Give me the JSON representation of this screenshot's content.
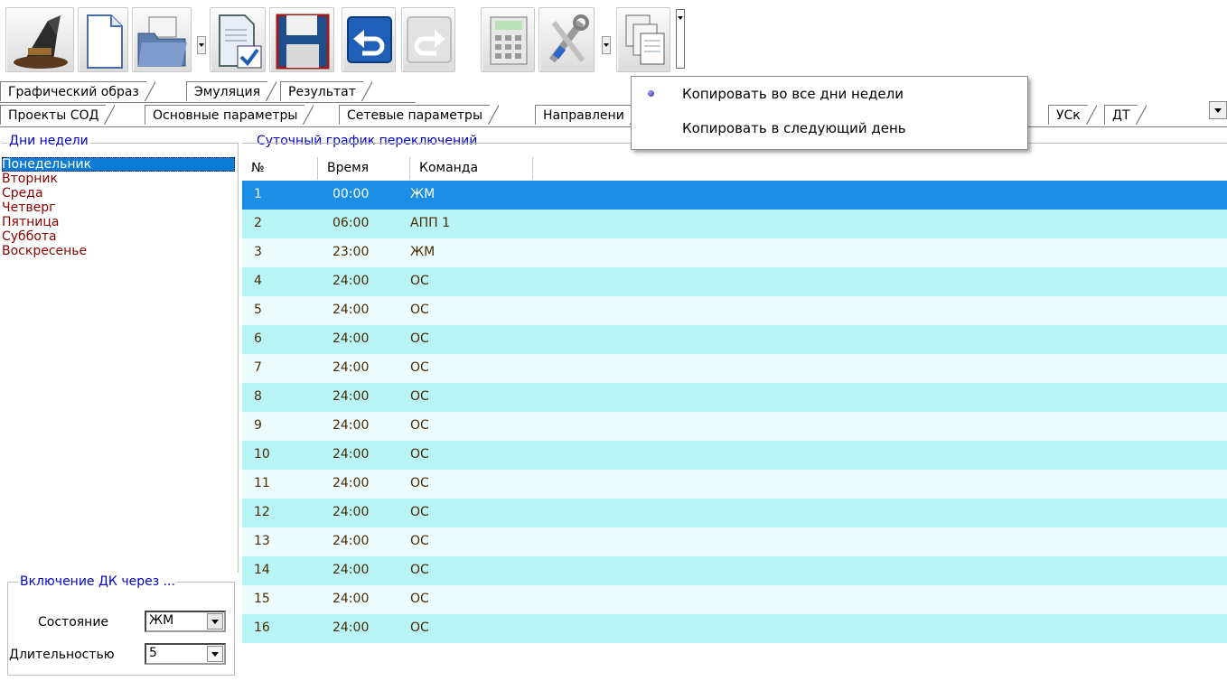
{
  "toolbar": {
    "icons": [
      "wizard-hat-icon",
      "new-document-icon",
      "open-folder-icon",
      "check-document-icon",
      "save-disk-icon",
      "undo-icon",
      "redo-icon",
      "calculator-icon",
      "tools-icon",
      "copy-documents-icon"
    ]
  },
  "tabs_top": [
    "Графический образ",
    "Эмуляция",
    "Результат"
  ],
  "tabs_second": [
    "Проекты СОД",
    "Основные параметры",
    "Сетевые параметры",
    "Направлени",
    "УСк",
    "ДТ"
  ],
  "left": {
    "days_title": "Дни недели",
    "days": [
      "Понедельник",
      "Вторник",
      "Среда",
      "Четверг",
      "Пятница",
      "Суббота",
      "Воскресенье"
    ],
    "dk_title": "Включение ДК через ...",
    "state_label": "Состояние",
    "state_value": "ЖМ",
    "duration_label": "Длительностью",
    "duration_value": "5"
  },
  "schedule": {
    "title": "Суточный график переключений",
    "columns": [
      "№",
      "Время",
      "Команда"
    ],
    "rows": [
      {
        "n": "1",
        "t": "00:00",
        "c": "ЖМ"
      },
      {
        "n": "2",
        "t": "06:00",
        "c": "АПП 1"
      },
      {
        "n": "3",
        "t": "23:00",
        "c": "ЖМ"
      },
      {
        "n": "4",
        "t": "24:00",
        "c": "ОС"
      },
      {
        "n": "5",
        "t": "24:00",
        "c": "ОС"
      },
      {
        "n": "6",
        "t": "24:00",
        "c": "ОС"
      },
      {
        "n": "7",
        "t": "24:00",
        "c": "ОС"
      },
      {
        "n": "8",
        "t": "24:00",
        "c": "ОС"
      },
      {
        "n": "9",
        "t": "24:00",
        "c": "ОС"
      },
      {
        "n": "10",
        "t": "24:00",
        "c": "ОС"
      },
      {
        "n": "11",
        "t": "24:00",
        "c": "ОС"
      },
      {
        "n": "12",
        "t": "24:00",
        "c": "ОС"
      },
      {
        "n": "13",
        "t": "24:00",
        "c": "ОС"
      },
      {
        "n": "14",
        "t": "24:00",
        "c": "ОС"
      },
      {
        "n": "15",
        "t": "24:00",
        "c": "ОС"
      },
      {
        "n": "16",
        "t": "24:00",
        "c": "ОС"
      }
    ]
  },
  "menu": {
    "items": [
      "Копировать во все дни недели",
      "Копировать в следующий день"
    ]
  },
  "colors": {
    "selected_row": "#1c8ee6",
    "row_light": "#ebfdfd",
    "row_dark": "#b8f4f6",
    "day_text": "#8b0000",
    "group_title": "#0000cc"
  }
}
